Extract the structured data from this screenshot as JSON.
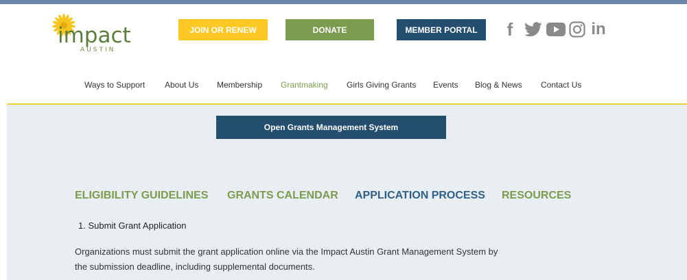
{
  "header": {
    "logo": {
      "wordmark": "impact",
      "subtitle": "AUSTIN",
      "flower_color": "#f6c51d"
    },
    "buttons": {
      "join": "JOIN OR RENEW",
      "donate": "DONATE",
      "member_portal": "MEMBER PORTAL"
    },
    "social": [
      {
        "icon": "facebook-icon",
        "glyph": "f"
      },
      {
        "icon": "twitter-icon"
      },
      {
        "icon": "youtube-icon"
      },
      {
        "icon": "instagram-icon"
      },
      {
        "icon": "linkedin-icon",
        "glyph": "in"
      }
    ]
  },
  "nav": {
    "items": [
      {
        "label": "Ways to Support"
      },
      {
        "label": "About Us"
      },
      {
        "label": "Membership"
      },
      {
        "label": "Grantmaking",
        "active": true
      },
      {
        "label": "Girls Giving Grants"
      },
      {
        "label": "Events"
      },
      {
        "label": "Blog & News"
      },
      {
        "label": "Contact Us"
      }
    ]
  },
  "main": {
    "open_button": "Open Grants Management System",
    "tabs": [
      {
        "label": "ELIGIBILITY GUIDELINES"
      },
      {
        "label": "GRANTS CALENDAR"
      },
      {
        "label": "APPLICATION PROCESS",
        "active": true
      },
      {
        "label": "RESOURCES"
      }
    ],
    "section_heading": "1. Submit Grant Application",
    "body_line1": "Organizations must submit the grant application online via the Impact Austin Grant Management System by",
    "body_line2": "the submission deadline, including supplemental documents."
  },
  "colors": {
    "top_strip": "#6b86ab",
    "join": "#fcc824",
    "donate": "#7b9c4e",
    "member_portal": "#244e6d",
    "accent_green": "#7b9c4e",
    "accent_blue": "#2f5f84",
    "gold_line": "#f0cf43",
    "main_bg": "#e9eef2",
    "social_grey": "#8a8a8a"
  }
}
